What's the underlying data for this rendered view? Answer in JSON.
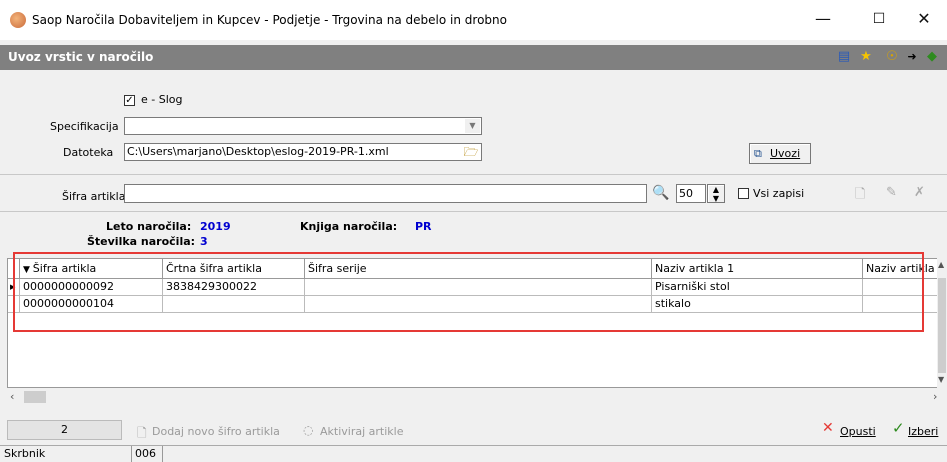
{
  "window": {
    "title": "Saop  Naročila Dobaviteljem in Kupcev - Podjetje - Trgovina na debelo in drobno",
    "minimize": "—",
    "maximize": "☐",
    "close": "✕"
  },
  "header": {
    "title": "Uvoz vrstic v naročilo"
  },
  "form": {
    "eslog_label": "e - Slog",
    "eslog_checked": "✓",
    "specifikacija_label": "Specifikacija",
    "specifikacija_value": "",
    "datoteka_label": "Datoteka",
    "datoteka_value": "C:\\Users\\marjano\\Desktop\\eslog-2019-PR-1.xml",
    "uvozi_label": "Uvozi"
  },
  "search": {
    "sifra_label": "Šifra artikla",
    "sifra_value": "",
    "count": "50",
    "vsi_zapisi_label": "Vsi zapisi"
  },
  "info": {
    "leto_label": "Leto naročila:",
    "leto_value": "2019",
    "knjiga_label": "Knjiga naročila:",
    "knjiga_value": "PR",
    "stevilka_label": "Številka naročila:",
    "stevilka_value": "3"
  },
  "grid": {
    "columns": [
      "Šifra artikla",
      "Črtna šifra artikla",
      "Šifra serije",
      "Naziv artikla 1",
      "Naziv artikla"
    ],
    "rows": [
      [
        "0000000000092",
        "3838429300022",
        "",
        "Pisarniški stol",
        ""
      ],
      [
        "0000000000104",
        "",
        "",
        "stikalo",
        ""
      ]
    ]
  },
  "bottom": {
    "count": "2",
    "dodaj_label": "Dodaj novo šifro artikla",
    "aktiviraj_label": "Aktiviraj artikle",
    "opusti_label": "Opusti",
    "izberi_label": "Izberi"
  },
  "status": {
    "user": "Skrbnik",
    "code": "006"
  },
  "colors": {
    "header_bg": "#808080",
    "highlight_border": "#e53935",
    "value_blue": "#0000d0"
  }
}
